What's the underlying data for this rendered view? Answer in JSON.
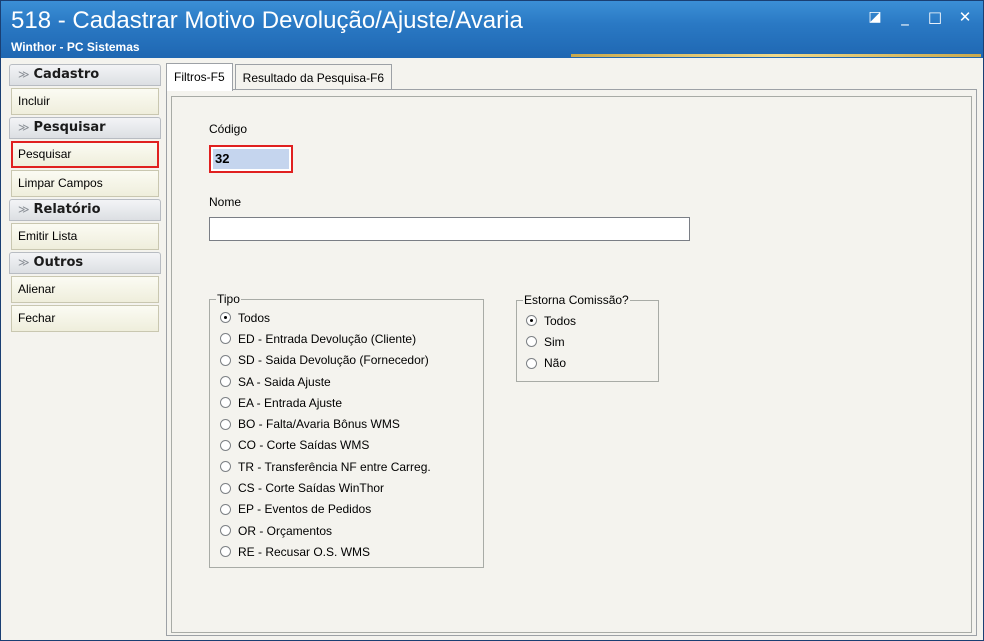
{
  "window": {
    "title": "518 - Cadastrar Motivo Devolução/Ajuste/Avaria",
    "subtitle": "Winthor - PC Sistemas",
    "controls": {
      "restore": "◪",
      "minimize": "_",
      "maximize": "□",
      "close": "✕"
    }
  },
  "sidebar": {
    "groups": [
      {
        "header": "Cadastro",
        "items": [
          {
            "label": "Incluir"
          }
        ]
      },
      {
        "header": "Pesquisar",
        "items": [
          {
            "label": "Pesquisar"
          },
          {
            "label": "Limpar Campos"
          }
        ]
      },
      {
        "header": "Relatório",
        "items": [
          {
            "label": "Emitir Lista"
          }
        ]
      },
      {
        "header": "Outros",
        "items": [
          {
            "label": "Alienar"
          },
          {
            "label": "Fechar"
          }
        ]
      }
    ]
  },
  "tabs": [
    {
      "label": "Filtros-F5",
      "active": true
    },
    {
      "label": "Resultado da Pesquisa-F6",
      "active": false
    }
  ],
  "form": {
    "codigo_label": "Código",
    "codigo_value": "32",
    "nome_label": "Nome",
    "nome_value": "",
    "tipo": {
      "legend": "Tipo",
      "options": [
        {
          "label": "Todos",
          "checked": true
        },
        {
          "label": "ED - Entrada Devolução (Cliente)",
          "checked": false
        },
        {
          "label": "SD - Saida Devolução (Fornecedor)",
          "checked": false
        },
        {
          "label": "SA - Saida Ajuste",
          "checked": false
        },
        {
          "label": "EA - Entrada Ajuste",
          "checked": false
        },
        {
          "label": "BO - Falta/Avaria Bônus WMS",
          "checked": false
        },
        {
          "label": "CO - Corte Saídas WMS",
          "checked": false
        },
        {
          "label": "TR - Transferência NF entre Carreg.",
          "checked": false
        },
        {
          "label": "CS - Corte Saídas WinThor",
          "checked": false
        },
        {
          "label": "EP - Eventos de Pedidos",
          "checked": false
        },
        {
          "label": "OR - Orçamentos",
          "checked": false
        },
        {
          "label": "RE - Recusar O.S. WMS",
          "checked": false
        }
      ]
    },
    "estorna": {
      "legend": "Estorna Comissão?",
      "options": [
        {
          "label": "Todos",
          "checked": true
        },
        {
          "label": "Sim",
          "checked": false
        },
        {
          "label": "Não",
          "checked": false
        }
      ]
    }
  },
  "colors": {
    "titlebar": "#2a79c4",
    "highlight": "#e02020",
    "selection": "#c5d5ee"
  }
}
